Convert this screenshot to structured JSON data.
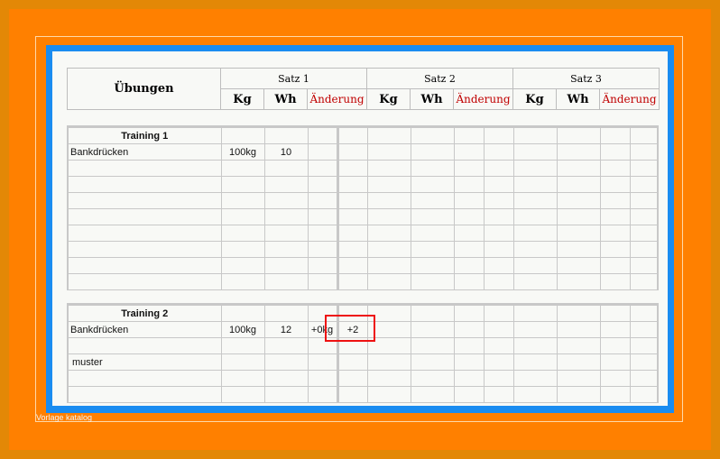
{
  "header": {
    "exercises_label": "Übungen",
    "sets": [
      "Satz 1",
      "Satz 2",
      "Satz 3"
    ],
    "kg_label": "Kg",
    "reps_label": "Wh",
    "change_label": "Änderung"
  },
  "training1": {
    "title": "Training 1",
    "rows": [
      {
        "exercise": "Bankdrücken",
        "kg1": "100kg",
        "wh1": "10",
        "change_kg": "",
        "change_wh": ""
      }
    ]
  },
  "training2": {
    "title": "Training 2",
    "rows": [
      {
        "exercise": "Bankdrücken",
        "kg1": "100kg",
        "wh1": "12",
        "change_kg": "+0kg",
        "change_wh": "+2"
      }
    ]
  },
  "watermark": "muster",
  "caption": "Vorlage katalog",
  "colors": {
    "outer": "#e38806",
    "frame": "#ff8000",
    "border": "#1a8cf0",
    "change_label": "#c00000",
    "highlight": "#ee1111"
  }
}
